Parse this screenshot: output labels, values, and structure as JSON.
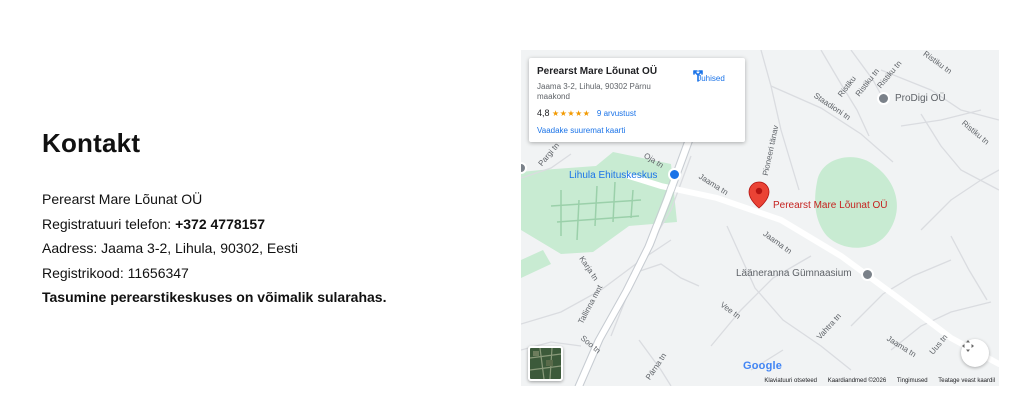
{
  "contact": {
    "title": "Kontakt",
    "clinic_name": "Perearst Mare Lõunat OÜ",
    "phone_label": "Registratuuri telefon: ",
    "phone": "+372 4778157",
    "address": "Aadress: Jaama 3-2, Lihula, 90302, Eesti",
    "reg_code": "Registrikood: 11656347",
    "payment_note": "Tasumine perearstikeskuses on võimalik sularahas."
  },
  "map": {
    "card": {
      "place_name": "Perearst Mare Lõunat OÜ",
      "address": "Jaama 3-2, Lihula, 90302 Pärnu maakond",
      "rating": "4,8",
      "stars": "★★★★★",
      "reviews": "9 arvustust",
      "larger_map": "Vaadake suuremat kaarti",
      "directions": "Juhised"
    },
    "pin_label": "Perearst Mare Lõunat OÜ",
    "pois": {
      "prodigi": "ProDigi OÜ",
      "ehituskeskus": "Lihula Ehituskeskus",
      "gymnasium": "Lääneranna Gümnaasium"
    },
    "streets": {
      "pargi": "Pargi tn",
      "oja": "Oja tn",
      "jaama1": "Jaama tn",
      "jaama2": "Jaama tn",
      "jaama3": "Jaama tn",
      "tallinna": "Tallinna mnt",
      "karja": "Karja tn",
      "soo": "Soo tn",
      "parna": "Pärna tn",
      "vee": "Vee tn",
      "vahtra": "Vahtra tn",
      "uus": "Uus tn",
      "pioneeri": "Pioneeri tänav",
      "staadioni": "Staadioni tn",
      "ristiku1": "Ristiku",
      "ristiku2": "Ristiku tn",
      "ristiku3": "Ristiku tn",
      "ristiku4": "Ristiku tn",
      "ristiku5": "Ristiku tn"
    },
    "google": "Google",
    "footer": {
      "shortcuts": "Klaviatuuri otseteed",
      "map_data": "Kaardiandmed ©2026",
      "terms": "Tingimused",
      "report": "Teatage veast kaardil"
    },
    "colors": {
      "land": "#f1f3f4",
      "park": "#c8ebd2",
      "road": "#ffffff",
      "pin": "#ea4335",
      "poi_blue": "#1a73e8",
      "link": "#1a73e8"
    }
  }
}
